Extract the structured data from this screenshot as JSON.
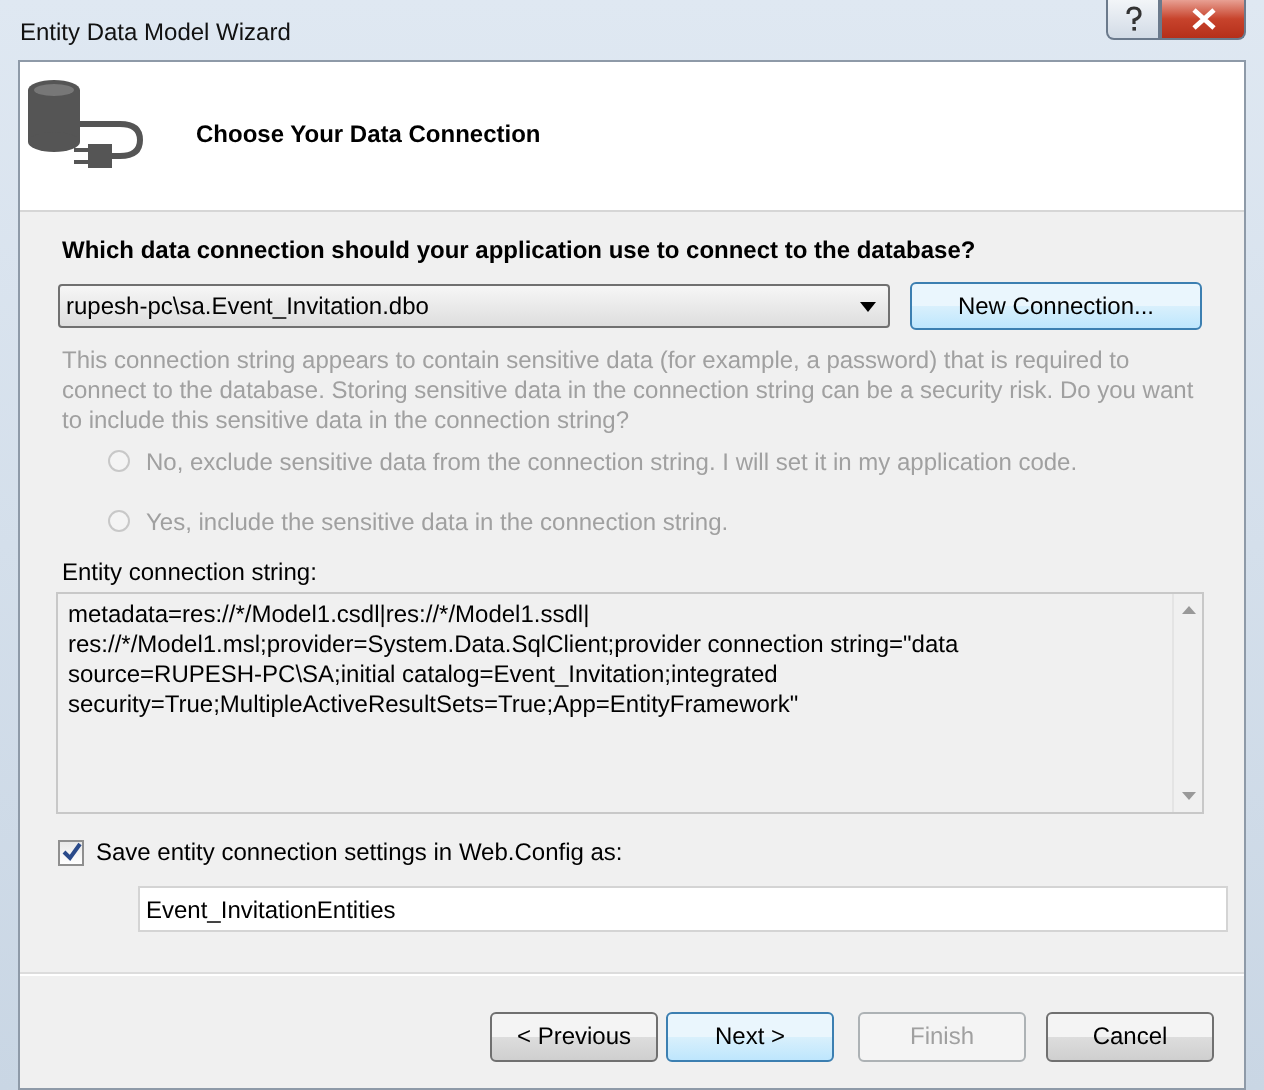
{
  "window": {
    "title": "Entity Data Model Wizard"
  },
  "header": {
    "title": "Choose Your Data Connection"
  },
  "question": "Which data connection should your application use to connect to the database?",
  "connection": {
    "value": "rupesh-pc\\sa.Event_Invitation.dbo",
    "button": "New Connection..."
  },
  "warning": {
    "text": "This connection string appears to contain sensitive data (for example, a password) that is required to connect to the database. Storing sensitive data in the connection string can be a security risk. Do you want to include this sensitive data in the connection string?",
    "disabled": true
  },
  "options": [
    {
      "label": "No, exclude sensitive data from the connection string. I will set it in my application code.",
      "selected": false,
      "disabled": true
    },
    {
      "label": "Yes, include the sensitive data in the connection string.",
      "selected": false,
      "disabled": true
    }
  ],
  "entity_string": {
    "label": "Entity connection string:",
    "value": "metadata=res://*/Model1.csdl|res://*/Model1.ssdl|\nres://*/Model1.msl;provider=System.Data.SqlClient;provider connection string=\"data\nsource=RUPESH-PC\\SA;initial catalog=Event_Invitation;integrated\nsecurity=True;MultipleActiveResultSets=True;App=EntityFramework\""
  },
  "save_settings": {
    "label": "Save entity connection settings in Web.Config as:",
    "checked": true,
    "value": "Event_InvitationEntities"
  },
  "buttons": [
    {
      "label": "< Previous",
      "disabled": false,
      "default": false
    },
    {
      "label": "Next >",
      "disabled": false,
      "default": true
    },
    {
      "label": "Finish",
      "disabled": true,
      "default": false
    },
    {
      "label": "Cancel",
      "disabled": false,
      "default": false
    }
  ]
}
